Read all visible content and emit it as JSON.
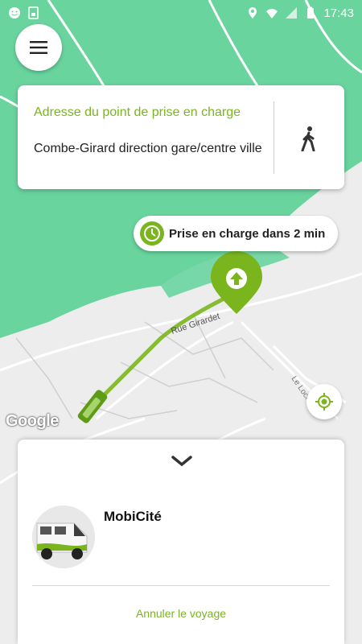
{
  "status_bar": {
    "time": "17:43",
    "left_icons": [
      "smiley-icon",
      "sim-icon"
    ],
    "right_icons": [
      "location-icon",
      "wifi-icon",
      "signal-icon",
      "battery-icon"
    ]
  },
  "map": {
    "street_label": "Rue Girardet",
    "street_label_2": "Le Locle",
    "attribution": "Google",
    "colors": {
      "forest": "#69d49e",
      "land": "#ededed",
      "road": "#ffffff",
      "route": "#7ab51d"
    }
  },
  "menu_button": {
    "icon": "menu-icon"
  },
  "pickup_card": {
    "title": "Adresse du point de prise en charge",
    "address": "Combe-Girard direction gare/centre ville",
    "mode_icon": "walking-icon"
  },
  "eta": {
    "text": "Prise en charge dans 2 min",
    "icon": "clock-icon"
  },
  "locate_button": {
    "icon": "my-location-icon"
  },
  "bottom_sheet": {
    "service_name": "MobiCité",
    "cancel_label": "Annuler le voyage",
    "chevron_icon": "chevron-down-icon",
    "accent": "#7ab51d"
  }
}
